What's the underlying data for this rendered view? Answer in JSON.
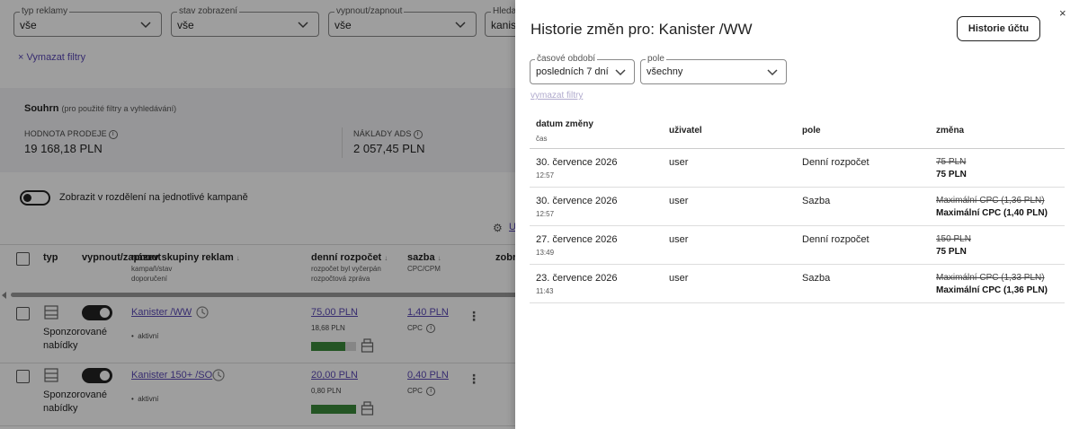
{
  "filters": [
    {
      "label": "typ reklamy",
      "value": "vše"
    },
    {
      "label": "stav zobrazení",
      "value": "vše"
    },
    {
      "label": "vypnout/zapnout",
      "value": "vše"
    },
    {
      "label": "Hleda",
      "value": "kanist"
    }
  ],
  "clear_filters": "× Vymazat filtry",
  "summary": {
    "title": "Souhrn",
    "subtitle": "(pro použité filtry a vyhledávání)",
    "kpis": [
      {
        "label": "HODNOTA PRODEJE",
        "value": "19 168,18 PLN"
      },
      {
        "label": "NÁKLADY ADS",
        "value": "2 057,45 PLN"
      }
    ]
  },
  "split_toggle_label": "Zobrazit v rozdělení na jednotlivé kampaně",
  "settings_link": "U",
  "table": {
    "headers": {
      "type": "typ",
      "onoff": "vypnout/zapnout",
      "name": "název skupiny reklam",
      "name_sub": [
        "kampaň/stav",
        "doporučení"
      ],
      "budget": "denní rozpočet",
      "budget_sub": [
        "rozpočet byl vyčerpán",
        "rozpočtová zpráva"
      ],
      "bid": "sazba",
      "bid_sub": "CPC/CPM",
      "display": "zobr"
    },
    "rows": [
      {
        "type": "Sponzorované nabídky",
        "name": "Kanister /WW",
        "status": "aktivní",
        "budget": "75,00 PLN",
        "spent": "18,68 PLN",
        "bid": "1,40 PLN",
        "bid_type": "CPC",
        "budget_fill": 0.75
      },
      {
        "type": "Sponzorované nabídky",
        "name": "Kanister 150+ /SO",
        "status": "aktivní",
        "budget": "20,00 PLN",
        "spent": "0,80 PLN",
        "bid": "0,40 PLN",
        "bid_type": "CPC",
        "budget_fill": 1.0
      }
    ]
  },
  "drawer": {
    "title": "Historie změn pro: Kanister /WW",
    "account_history_button": "Historie účtu",
    "close": "×",
    "period": {
      "label": "časové období",
      "value": "posledních 7 dní"
    },
    "field": {
      "label": "pole",
      "value": "všechny"
    },
    "clear_filters": "vymazat filtry",
    "columns": {
      "date": "datum změny",
      "time": "čas",
      "user": "uživatel",
      "field": "pole",
      "change": "změna"
    },
    "rows": [
      {
        "date": "30. července 2026",
        "time": "12:57",
        "user": "user",
        "field": "Denní rozpočet",
        "old": "75 PLN",
        "new": "75 PLN"
      },
      {
        "date": "30. července 2026",
        "time": "12:57",
        "user": "user",
        "field": "Sazba",
        "old": "Maximální CPC (1,36 PLN)",
        "new": "Maximální CPC (1,40 PLN)"
      },
      {
        "date": "27. července 2026",
        "time": "13:49",
        "user": "user",
        "field": "Denní rozpočet",
        "old": "150 PLN",
        "new": "75 PLN"
      },
      {
        "date": "23. července 2026",
        "time": "11:43",
        "user": "user",
        "field": "Sazba",
        "old": "Maximální CPC (1,33 PLN)",
        "new": "Maximální CPC (1,36 PLN)"
      }
    ]
  }
}
